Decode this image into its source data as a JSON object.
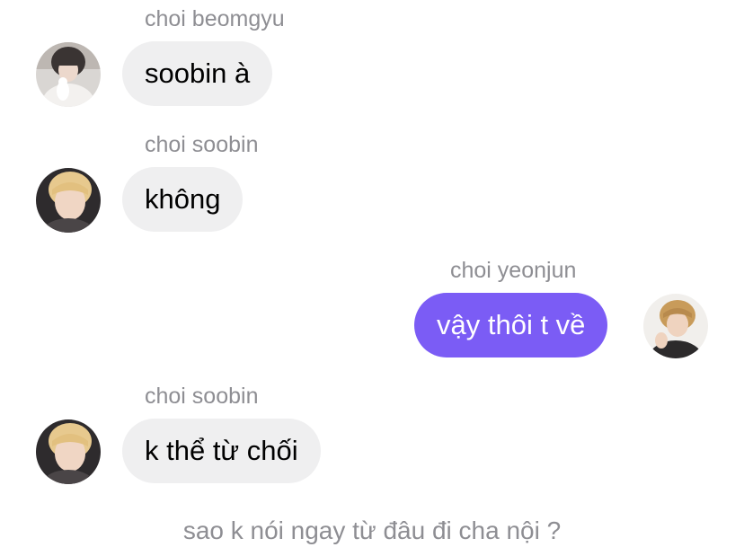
{
  "messages": [
    {
      "sender": "choi beomgyu",
      "text": "soobin à",
      "avatar": "beomgyu-avatar",
      "direction": "incoming"
    },
    {
      "sender": "choi soobin",
      "text": "không",
      "avatar": "soobin-avatar",
      "direction": "incoming"
    },
    {
      "sender": "choi yeonjun",
      "text": "vậy thôi t về",
      "avatar": "yeonjun-avatar",
      "direction": "outgoing"
    },
    {
      "sender": "choi soobin",
      "text": "k thể từ chối",
      "avatar": "soobin-avatar",
      "direction": "incoming"
    }
  ],
  "footer_note": "sao k nói ngay từ đâu đi cha nội ?",
  "colors": {
    "incoming_bubble": "#efeff0",
    "outgoing_bubble": "#7b5cf5",
    "sender_text": "#8e8e93"
  }
}
